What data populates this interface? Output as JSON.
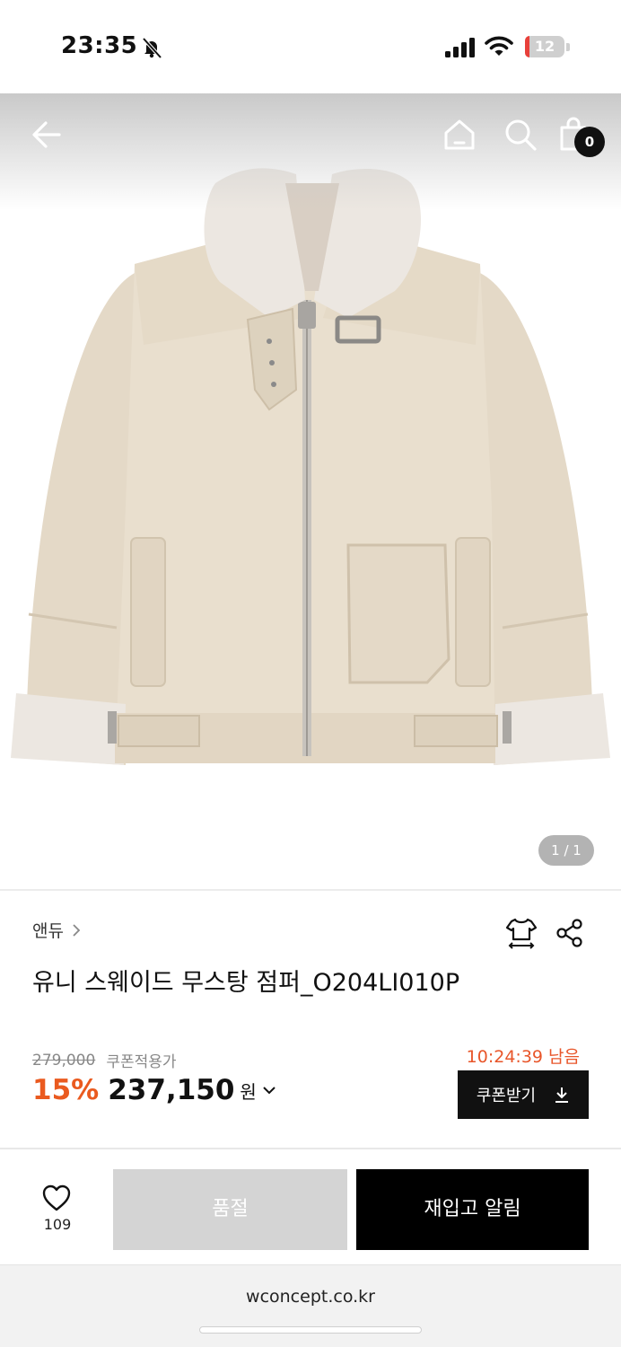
{
  "status_bar": {
    "time": "23:35",
    "battery_level": "12",
    "battery_fraction": 0.12,
    "icons": [
      "bell-slash-icon",
      "cellular-signal-icon",
      "wifi-icon",
      "battery-icon"
    ]
  },
  "header": {
    "icons": [
      "back-arrow-icon",
      "home-icon",
      "search-icon",
      "shopping-bag-icon"
    ],
    "cart_count": "0"
  },
  "gallery": {
    "page_indicator": "1 / 1",
    "image_subject": "jacket-product-photo"
  },
  "product": {
    "brand": "앤듀",
    "name": "유니 스웨이드 무스탕 점퍼_O204LI010P",
    "original_price": "279,000",
    "coupon_note": "쿠폰적용가",
    "discount": "15%",
    "sale_price": "237,150",
    "currency": "원",
    "timer": "10:24:39 남음",
    "coupon_button": "쿠폰받기",
    "icons": [
      "size-guide-icon",
      "share-icon",
      "chevron-right-icon",
      "chevron-down-icon",
      "download-icon"
    ]
  },
  "actions": {
    "like_count": "109",
    "sold_out_label": "품절",
    "restock_label": "재입고 알림",
    "icons": [
      "heart-icon"
    ]
  },
  "browser": {
    "url": "wconcept.co.kr"
  },
  "colors": {
    "accent": "#ea5a1f",
    "timer": "#e8562a",
    "dark_button": "#111111",
    "disabled_button": "#d4d4d4",
    "jacket": "#e6dccb",
    "shearling": "#ece7e1"
  }
}
